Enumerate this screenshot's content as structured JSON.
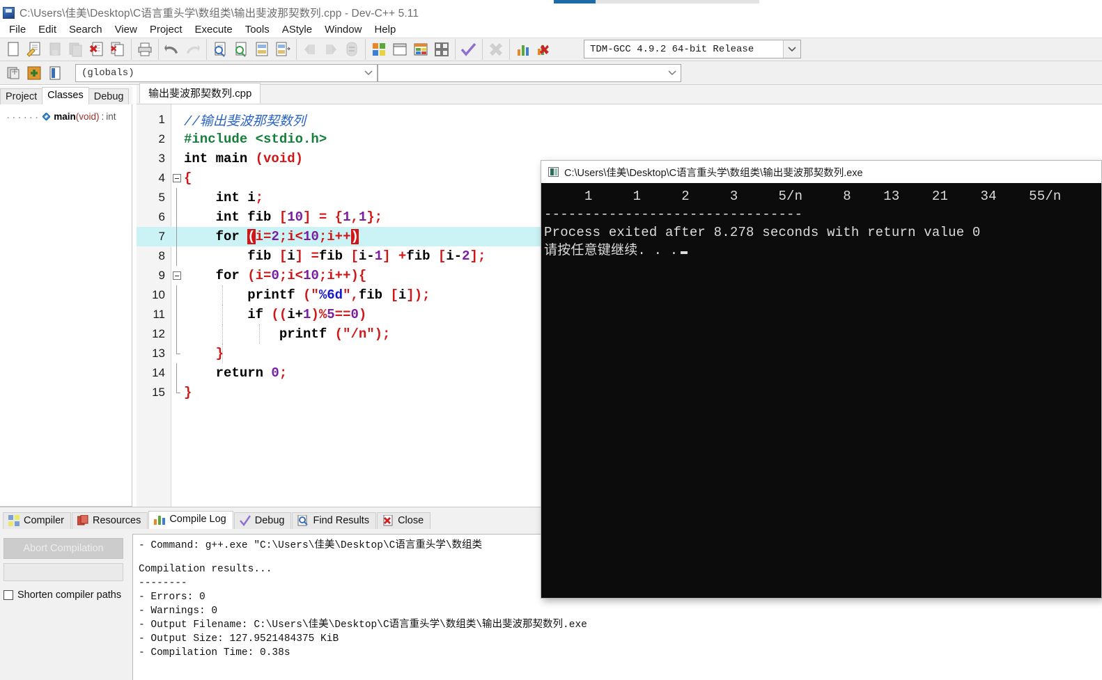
{
  "window": {
    "title": "C:\\Users\\佳美\\Desktop\\C语言重头学\\数组类\\输出斐波那契数列.cpp - Dev-C++ 5.11",
    "app_icon": "devcpp-icon"
  },
  "menu": {
    "items": [
      {
        "label": "File"
      },
      {
        "label": "Edit"
      },
      {
        "label": "Search"
      },
      {
        "label": "View"
      },
      {
        "label": "Project"
      },
      {
        "label": "Execute"
      },
      {
        "label": "Tools"
      },
      {
        "label": "AStyle"
      },
      {
        "label": "Window"
      },
      {
        "label": "Help"
      }
    ]
  },
  "toolbar": {
    "compiler_set": "TDM-GCC 4.9.2 64-bit Release",
    "globals": "(globals)",
    "buttons": [
      {
        "name": "new-file-icon"
      },
      {
        "name": "open-file-icon"
      },
      {
        "name": "save-file-icon"
      },
      {
        "name": "save-all-icon"
      },
      {
        "name": "close-file-icon"
      },
      {
        "name": "close-all-icon"
      },
      {
        "name": "print-icon"
      },
      {
        "name": "undo-icon"
      },
      {
        "name": "redo-icon"
      },
      {
        "name": "find-icon"
      },
      {
        "name": "replace-icon"
      },
      {
        "name": "goto-line-icon"
      },
      {
        "name": "goto-function-icon"
      },
      {
        "name": "back-icon"
      },
      {
        "name": "forward-icon"
      },
      {
        "name": "toggle-bookmark-icon"
      },
      {
        "name": "compile-icon"
      },
      {
        "name": "run-icon"
      },
      {
        "name": "compile-and-run-icon"
      },
      {
        "name": "rebuild-all-icon"
      },
      {
        "name": "syntax-check-icon"
      },
      {
        "name": "stop-execution-icon"
      },
      {
        "name": "profile-icon"
      },
      {
        "name": "delete-profile-icon"
      }
    ],
    "row2_buttons": [
      {
        "name": "new-project-icon"
      },
      {
        "name": "add-to-project-icon"
      },
      {
        "name": "remove-from-project-icon"
      }
    ]
  },
  "left_panel": {
    "tabs": [
      {
        "label": "Project",
        "active": false
      },
      {
        "label": "Classes",
        "active": true
      },
      {
        "label": "Debug",
        "active": false
      }
    ],
    "tree": [
      {
        "dashes": "......",
        "icon": "function-diamond-icon",
        "name": "main",
        "params": "(void)",
        "colon": ":",
        "return_type": "int"
      }
    ]
  },
  "editor": {
    "file_tab": "输出斐波那契数列.cpp",
    "highlight_line": 7,
    "lines": [
      {
        "n": 1,
        "fold": "none",
        "tokens": [
          {
            "t": "//输出斐波那契数列",
            "c": "t-com"
          }
        ]
      },
      {
        "n": 2,
        "fold": "none",
        "tokens": [
          {
            "t": "#include <stdio.h>",
            "c": "t-pre"
          }
        ]
      },
      {
        "n": 3,
        "fold": "none",
        "tokens": [
          {
            "t": "int main ",
            "c": "t-kw"
          },
          {
            "t": "(void)",
            "c": "t-pun"
          }
        ]
      },
      {
        "n": 4,
        "fold": "start",
        "tokens": [
          {
            "t": "{",
            "c": "t-pun"
          }
        ]
      },
      {
        "n": 5,
        "fold": "bar",
        "tokens": [
          {
            "t": "    int i",
            "c": "t-kw"
          },
          {
            "t": ";",
            "c": "t-pun"
          }
        ]
      },
      {
        "n": 6,
        "fold": "bar",
        "tokens": [
          {
            "t": "    int fib ",
            "c": "t-kw"
          },
          {
            "t": "[",
            "c": "t-pun"
          },
          {
            "t": "10",
            "c": "t-num"
          },
          {
            "t": "] = {",
            "c": "t-pun"
          },
          {
            "t": "1",
            "c": "t-num"
          },
          {
            "t": ",",
            "c": "t-pun"
          },
          {
            "t": "1",
            "c": "t-num"
          },
          {
            "t": "};",
            "c": "t-pun"
          }
        ]
      },
      {
        "n": 7,
        "fold": "bar",
        "tokens": [
          {
            "t": "    for ",
            "c": "t-kw"
          },
          {
            "t": "(",
            "c": "t-hlbr"
          },
          {
            "t": "i=",
            "c": "t-pun"
          },
          {
            "t": "2",
            "c": "t-num"
          },
          {
            "t": ";",
            "c": "t-pun"
          },
          {
            "t": "i<",
            "c": "t-pun"
          },
          {
            "t": "10",
            "c": "t-num"
          },
          {
            "t": ";",
            "c": "t-pun"
          },
          {
            "t": "i++",
            "c": "t-pun"
          },
          {
            "t": ")",
            "c": "t-hlbr"
          }
        ]
      },
      {
        "n": 8,
        "fold": "bar",
        "tokens": [
          {
            "t": "        fib ",
            "c": "t-kw"
          },
          {
            "t": "[",
            "c": "t-pun"
          },
          {
            "t": "i",
            "c": "t-kw"
          },
          {
            "t": "] =",
            "c": "t-pun"
          },
          {
            "t": "fib ",
            "c": "t-kw"
          },
          {
            "t": "[",
            "c": "t-pun"
          },
          {
            "t": "i-",
            "c": "t-kw"
          },
          {
            "t": "1",
            "c": "t-num"
          },
          {
            "t": "] +",
            "c": "t-pun"
          },
          {
            "t": "fib ",
            "c": "t-kw"
          },
          {
            "t": "[",
            "c": "t-pun"
          },
          {
            "t": "i-",
            "c": "t-kw"
          },
          {
            "t": "2",
            "c": "t-num"
          },
          {
            "t": "];",
            "c": "t-pun"
          }
        ]
      },
      {
        "n": 9,
        "fold": "start2",
        "tokens": [
          {
            "t": "    for ",
            "c": "t-kw"
          },
          {
            "t": "(",
            "c": "t-pun"
          },
          {
            "t": "i=",
            "c": "t-pun"
          },
          {
            "t": "0",
            "c": "t-num"
          },
          {
            "t": ";",
            "c": "t-pun"
          },
          {
            "t": "i<",
            "c": "t-pun"
          },
          {
            "t": "10",
            "c": "t-num"
          },
          {
            "t": ";",
            "c": "t-pun"
          },
          {
            "t": "i++",
            "c": "t-pun"
          },
          {
            "t": "){",
            "c": "t-pun"
          }
        ]
      },
      {
        "n": 10,
        "fold": "bar2",
        "tokens": [
          {
            "t": "        printf ",
            "c": "t-kw"
          },
          {
            "t": "(\"",
            "c": "t-pun"
          },
          {
            "t": "%6d",
            "c": "t-strin"
          },
          {
            "t": "\",",
            "c": "t-pun"
          },
          {
            "t": "fib ",
            "c": "t-kw"
          },
          {
            "t": "[",
            "c": "t-pun"
          },
          {
            "t": "i",
            "c": "t-kw"
          },
          {
            "t": "]);",
            "c": "t-pun"
          }
        ]
      },
      {
        "n": 11,
        "fold": "bar2",
        "tokens": [
          {
            "t": "        if ",
            "c": "t-kw"
          },
          {
            "t": "((",
            "c": "t-pun"
          },
          {
            "t": "i+",
            "c": "t-kw"
          },
          {
            "t": "1",
            "c": "t-num"
          },
          {
            "t": ")%",
            "c": "t-pun"
          },
          {
            "t": "5",
            "c": "t-num"
          },
          {
            "t": "==",
            "c": "t-pun"
          },
          {
            "t": "0",
            "c": "t-num"
          },
          {
            "t": ")",
            "c": "t-pun"
          }
        ]
      },
      {
        "n": 12,
        "fold": "bar2i",
        "tokens": [
          {
            "t": "            printf ",
            "c": "t-kw"
          },
          {
            "t": "(\"/n\");",
            "c": "t-str"
          }
        ]
      },
      {
        "n": 13,
        "fold": "end2",
        "tokens": [
          {
            "t": "    }",
            "c": "t-pun"
          }
        ]
      },
      {
        "n": 14,
        "fold": "bar",
        "tokens": [
          {
            "t": "    return ",
            "c": "t-kw"
          },
          {
            "t": "0",
            "c": "t-num"
          },
          {
            "t": ";",
            "c": "t-pun"
          }
        ]
      },
      {
        "n": 15,
        "fold": "end",
        "tokens": [
          {
            "t": "}",
            "c": "t-pun"
          }
        ]
      }
    ]
  },
  "console": {
    "title": "C:\\Users\\佳美\\Desktop\\C语言重头学\\数组类\\输出斐波那契数列.exe",
    "icon": "console-window-icon",
    "lines": [
      "     1     1     2     3     5/n     8    13    21    34    55/n",
      "--------------------------------",
      "Process exited after 8.278 seconds with return value 0",
      "请按任意键继续. . ."
    ],
    "cursor_visible": true
  },
  "bottom_panel": {
    "tabs": [
      {
        "label": "Compiler",
        "icon": "compiler-grid-icon",
        "active": false
      },
      {
        "label": "Resources",
        "icon": "resources-icon",
        "active": false
      },
      {
        "label": "Compile Log",
        "icon": "compile-log-chart-icon",
        "active": true
      },
      {
        "label": "Debug",
        "icon": "debug-check-icon",
        "active": false
      },
      {
        "label": "Find Results",
        "icon": "find-results-icon",
        "active": false
      },
      {
        "label": "Close",
        "icon": "close-red-icon",
        "active": false
      }
    ],
    "abort_button": "Abort Compilation",
    "shorten_paths_label": "Shorten compiler paths",
    "log_lines": [
      "- Command: g++.exe \"C:\\Users\\佳美\\Desktop\\C语言重头学\\数组类",
      "",
      "Compilation results...",
      "--------",
      "- Errors: 0",
      "- Warnings: 0",
      "- Output Filename: C:\\Users\\佳美\\Desktop\\C语言重头学\\数组类\\输出斐波那契数列.exe",
      "- Output Size: 127.9521484375 KiB",
      "- Compilation Time: 0.38s"
    ]
  },
  "colors": {
    "accent_blue": "#1b6ca8",
    "highlight_line": "#cbf3f5",
    "console_bg": "#0c0c0c",
    "bracket_match": "#d41515"
  }
}
